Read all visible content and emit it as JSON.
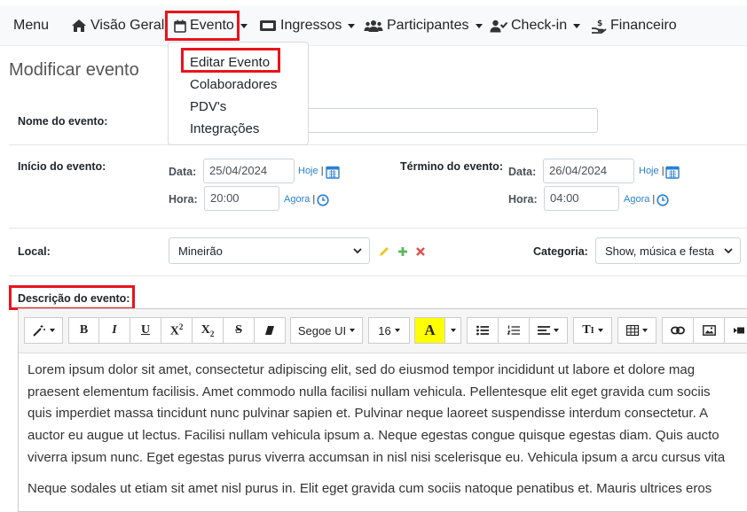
{
  "navbar": {
    "brand": "Menu",
    "items": [
      {
        "label": "Visão Geral",
        "icon": "home-icon"
      },
      {
        "label": "Evento",
        "icon": "calendar-icon"
      },
      {
        "label": "Ingressos",
        "icon": "ticket-icon"
      },
      {
        "label": "Participantes",
        "icon": "users-icon"
      },
      {
        "label": "Check-in",
        "icon": "user-check-icon"
      },
      {
        "label": "Financeiro",
        "icon": "dollar-hand-icon"
      }
    ]
  },
  "dropdown": {
    "items": [
      "Editar Evento",
      "Colaboradores",
      "PDV's",
      "Integrações"
    ]
  },
  "page": {
    "title": "Modificar evento"
  },
  "form": {
    "nome_label": "Nome do evento:",
    "nome_value": "",
    "inicio_label": "Início do evento:",
    "termino_label": "Término do evento:",
    "data_label": "Data:",
    "hora_label": "Hora:",
    "inicio_data": "25/04/2024",
    "inicio_hora": "20:00",
    "termino_data": "26/04/2024",
    "termino_hora": "04:00",
    "hoje_link": "Hoje",
    "agora_link": "Agora",
    "separator": "|",
    "local_label": "Local:",
    "local_value": "Mineirão",
    "categoria_label": "Categoria:",
    "categoria_value": "Show, música e festa",
    "descricao_label": "Descrição do evento:"
  },
  "editor": {
    "font_name": "Segoe UI",
    "font_size": "16",
    "paragraphs": [
      [
        "Lorem ipsum dolor sit amet, consectetur adipiscing elit, sed do eiusmod tempor incididunt ut labore et dolore mag",
        "praesent elementum facilisis. Amet commodo nulla facilisi nullam vehicula. Pellentesque elit eget gravida cum sociis",
        "quis imperdiet massa tincidunt nunc pulvinar sapien et. Pulvinar neque laoreet suspendisse interdum consectetur. A",
        "auctor eu augue ut lectus. Facilisi nullam vehicula ipsum a. Neque egestas congue quisque egestas diam. Quis aucto",
        "viverra ipsum nunc. Eget egestas purus viverra accumsan in nisl nisi scelerisque eu. Vehicula ipsum a arcu cursus vita"
      ],
      [
        "Neque sodales ut etiam sit amet nisl purus in. Elit eget gravida cum sociis natoque penatibus et. Mauris ultrices eros"
      ]
    ]
  },
  "colors": {
    "highlight": "#e8141c",
    "link": "#2a7fd4",
    "font_color_swatch": "#ffff00"
  }
}
